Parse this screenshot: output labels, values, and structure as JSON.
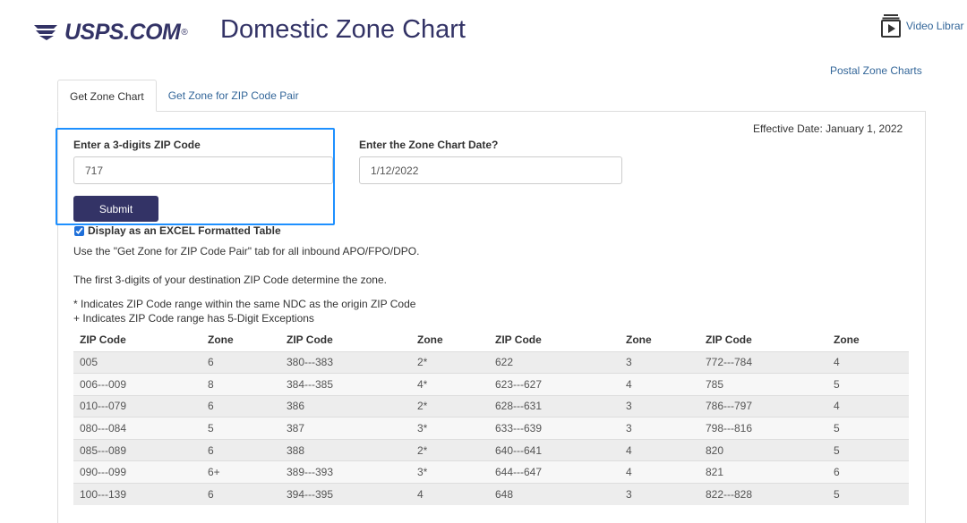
{
  "brand": {
    "logo_text": "USPS.COM",
    "logo_mark": "®"
  },
  "page": {
    "title": "Domestic Zone Chart"
  },
  "header": {
    "video_label": "Video Librar",
    "postal_zone_charts": "Postal Zone Charts"
  },
  "tabs": [
    {
      "label": "Get Zone Chart",
      "active": true
    },
    {
      "label": "Get Zone for ZIP Code Pair",
      "active": false
    }
  ],
  "effective_date": "Effective Date: January 1, 2022",
  "form": {
    "zip_label": "Enter a 3-digits ZIP Code",
    "zip_value": "717",
    "date_label": "Enter the Zone Chart Date?",
    "date_value": "1/12/2022",
    "submit_label": "Submit",
    "excel_label": "Display as an EXCEL Formatted Table",
    "excel_checked": true
  },
  "notes": {
    "apo": "Use the \"Get Zone for ZIP Code Pair\" tab for all inbound APO/FPO/DPO.",
    "first_digits": "The first 3-digits of your destination ZIP Code determine the zone.",
    "ndc": "* Indicates ZIP Code range within the same NDC as the origin ZIP Code",
    "exceptions": "+ Indicates ZIP Code range has 5-Digit Exceptions"
  },
  "table": {
    "headers": [
      "ZIP Code",
      "Zone",
      "ZIP Code",
      "Zone",
      "ZIP Code",
      "Zone",
      "ZIP Code",
      "Zone"
    ],
    "rows": [
      [
        "005",
        "6",
        "380---383",
        "2*",
        "622",
        "3",
        "772---784",
        "4"
      ],
      [
        "006---009",
        "8",
        "384---385",
        "4*",
        "623---627",
        "4",
        "785",
        "5"
      ],
      [
        "010---079",
        "6",
        "386",
        "2*",
        "628---631",
        "3",
        "786---797",
        "4"
      ],
      [
        "080---084",
        "5",
        "387",
        "3*",
        "633---639",
        "3",
        "798---816",
        "5"
      ],
      [
        "085---089",
        "6",
        "388",
        "2*",
        "640---641",
        "4",
        "820",
        "5"
      ],
      [
        "090---099",
        "6+",
        "389---393",
        "3*",
        "644---647",
        "4",
        "821",
        "6"
      ],
      [
        "100---139",
        "6",
        "394---395",
        "4",
        "648",
        "3",
        "822---828",
        "5"
      ]
    ]
  },
  "colors": {
    "brand_navy": "#333366",
    "link_blue": "#336699",
    "highlight": "#1e90ff"
  }
}
